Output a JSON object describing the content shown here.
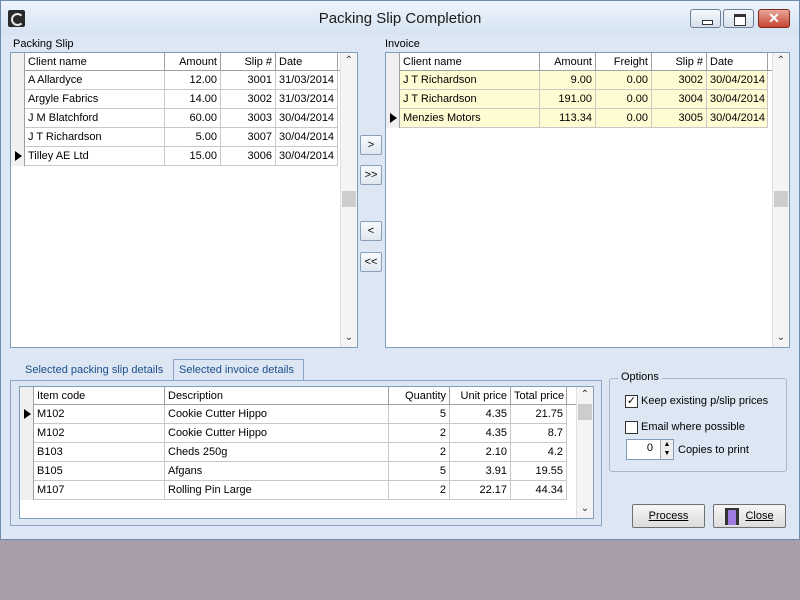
{
  "window": {
    "title": "Packing Slip Completion",
    "close_glyph": "✕"
  },
  "packing_slip": {
    "label": "Packing Slip",
    "headers": [
      "Client name",
      "Amount",
      "Slip #",
      "Date"
    ],
    "rows": [
      [
        "A Allardyce",
        "12.00",
        "3001",
        "31/03/2014"
      ],
      [
        "Argyle Fabrics",
        "14.00",
        "3002",
        "31/03/2014"
      ],
      [
        "J M Blatchford",
        "60.00",
        "3003",
        "30/04/2014"
      ],
      [
        "J T Richardson",
        "5.00",
        "3007",
        "30/04/2014"
      ],
      [
        "Tilley AE Ltd",
        "15.00",
        "3006",
        "30/04/2014"
      ]
    ]
  },
  "move_buttons": {
    "move_one_right": ">",
    "move_all_right": ">>",
    "move_one_left": "<",
    "move_all_left": "<<"
  },
  "invoice": {
    "label": "Invoice",
    "headers": [
      "Client name",
      "Amount",
      "Freight",
      "Slip #",
      "Date"
    ],
    "rows": [
      [
        "J T Richardson",
        "9.00",
        "0.00",
        "3002",
        "30/04/2014"
      ],
      [
        "J T Richardson",
        "191.00",
        "0.00",
        "3004",
        "30/04/2014"
      ],
      [
        "Menzies Motors",
        "113.34",
        "0.00",
        "3005",
        "30/04/2014"
      ]
    ]
  },
  "tabs": [
    "Selected packing slip details",
    "Selected invoice details"
  ],
  "details": {
    "headers": [
      "Item code",
      "Description",
      "Quantity",
      "Unit price",
      "Total price"
    ],
    "rows": [
      [
        "M102",
        "Cookie Cutter Hippo",
        "5",
        "4.35",
        "21.75"
      ],
      [
        "M102",
        "Cookie Cutter Hippo",
        "2",
        "4.35",
        "8.7"
      ],
      [
        "B103",
        "Cheds 250g",
        "2",
        "2.10",
        "4.2"
      ],
      [
        "B105",
        "Afgans",
        "5",
        "3.91",
        "19.55"
      ],
      [
        "M107",
        "Rolling Pin Large",
        "2",
        "22.17",
        "44.34"
      ]
    ]
  },
  "options": {
    "title": "Options",
    "keep_prices_label": "Keep existing p/slip prices",
    "keep_prices_checked": true,
    "check_glyph": "✓",
    "email_label": "Email where possible",
    "email_checked": false,
    "copies_value": "0",
    "copies_label": "Copies to print",
    "spin_up": "▲",
    "spin_down": "▼"
  },
  "scroll_glyphs": {
    "up": "⌃",
    "down": "⌄"
  },
  "buttons": {
    "process": "Process",
    "close": "Close"
  }
}
